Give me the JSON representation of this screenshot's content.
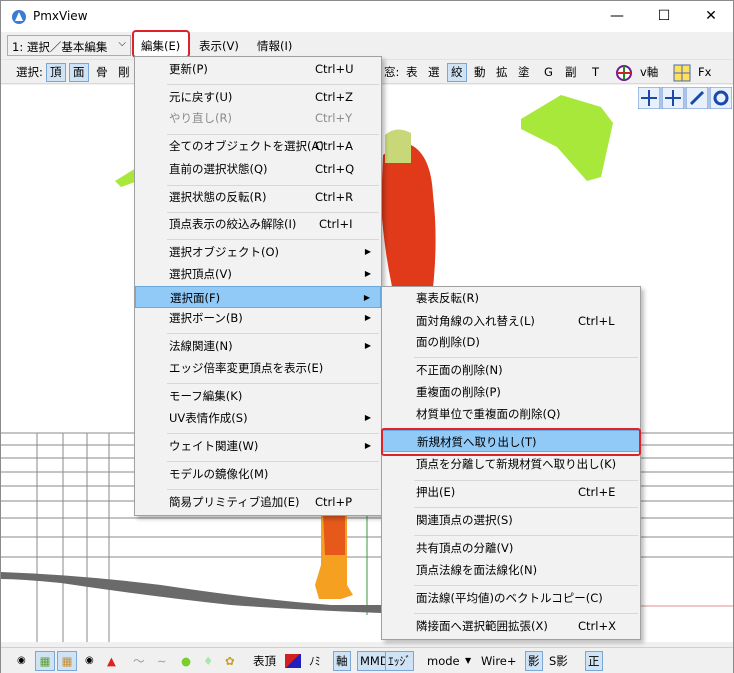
{
  "window": {
    "title": "PmxView"
  },
  "window_controls": {
    "minimize": "—",
    "maximize": "☐",
    "close": "✕"
  },
  "menubar": {
    "mode_select": "1: 選択／基本編集",
    "items": [
      "編集(E)",
      "表示(V)",
      "情報(I)"
    ]
  },
  "toolbar": {
    "left": [
      "選択:",
      "頂",
      "面",
      "骨",
      "剛"
    ],
    "right": [
      "窓:",
      "表",
      "選",
      "絞",
      "動",
      "拡",
      "塗",
      "G",
      "副",
      "T"
    ],
    "v_axis": "v軸",
    "fx": "Fx"
  },
  "edit_menu": {
    "items": [
      {
        "label": "更新(P)",
        "shortcut": "Ctrl+U"
      },
      {
        "label": "元に戻す(U)",
        "shortcut": "Ctrl+Z"
      },
      {
        "label": "やり直し(R)",
        "shortcut": "Ctrl+Y"
      },
      {
        "label": "全てのオブジェクトを選択(A)",
        "shortcut": "Ctrl+A"
      },
      {
        "label": "直前の選択状態(Q)",
        "shortcut": "Ctrl+Q"
      },
      {
        "label": "選択状態の反転(R)",
        "shortcut": "Ctrl+R"
      },
      {
        "label": "頂点表示の絞込み解除(I)",
        "shortcut": "Ctrl+I"
      },
      {
        "label": "選択オブジェクト(O)",
        "shortcut": ""
      },
      {
        "label": "選択頂点(V)",
        "shortcut": ""
      },
      {
        "label": "選択面(F)",
        "shortcut": ""
      },
      {
        "label": "選択ボーン(B)",
        "shortcut": ""
      },
      {
        "label": "法線関連(N)",
        "shortcut": ""
      },
      {
        "label": "エッジ倍率変更頂点を表示(E)",
        "shortcut": ""
      },
      {
        "label": "モーフ編集(K)",
        "shortcut": ""
      },
      {
        "label": "UV表情作成(S)",
        "shortcut": ""
      },
      {
        "label": "ウェイト関連(W)",
        "shortcut": ""
      },
      {
        "label": "モデルの鏡像化(M)",
        "shortcut": ""
      },
      {
        "label": "簡易プリミティブ追加(E)",
        "shortcut": "Ctrl+P"
      }
    ]
  },
  "face_submenu": {
    "items": [
      {
        "label": "裏表反転(R)",
        "shortcut": ""
      },
      {
        "label": "面対角線の入れ替え(L)",
        "shortcut": "Ctrl+L"
      },
      {
        "label": "面の削除(D)",
        "shortcut": ""
      },
      {
        "label": "不正面の削除(N)",
        "shortcut": ""
      },
      {
        "label": "重複面の削除(P)",
        "shortcut": ""
      },
      {
        "label": "材質単位で重複面の削除(Q)",
        "shortcut": ""
      },
      {
        "label": "新規材質へ取り出し(T)",
        "shortcut": ""
      },
      {
        "label": "頂点を分離して新規材質へ取り出し(K)",
        "shortcut": ""
      },
      {
        "label": "押出(E)",
        "shortcut": "Ctrl+E"
      },
      {
        "label": "関連頂点の選択(S)",
        "shortcut": ""
      },
      {
        "label": "共有頂点の分離(V)",
        "shortcut": ""
      },
      {
        "label": "頂点法線を面法線化(N)",
        "shortcut": ""
      },
      {
        "label": "面法線(平均値)のベクトルコピー(C)",
        "shortcut": ""
      },
      {
        "label": "隣接面へ選択範囲拡張(X)",
        "shortcut": "Ctrl+X"
      }
    ]
  },
  "bottombar": {
    "labels": [
      "表頂",
      "ﾉﾐ",
      "軸",
      "MMD",
      "ｴｯｼﾞ",
      "mode",
      "Wire+",
      "影",
      "S影",
      "正"
    ]
  },
  "colors": {
    "highlight_red": "#e0202a",
    "menu_active": "#91c9f7",
    "model_red": "#e03a1a",
    "model_orange": "#f5a020",
    "model_green": "#a8e83a"
  }
}
